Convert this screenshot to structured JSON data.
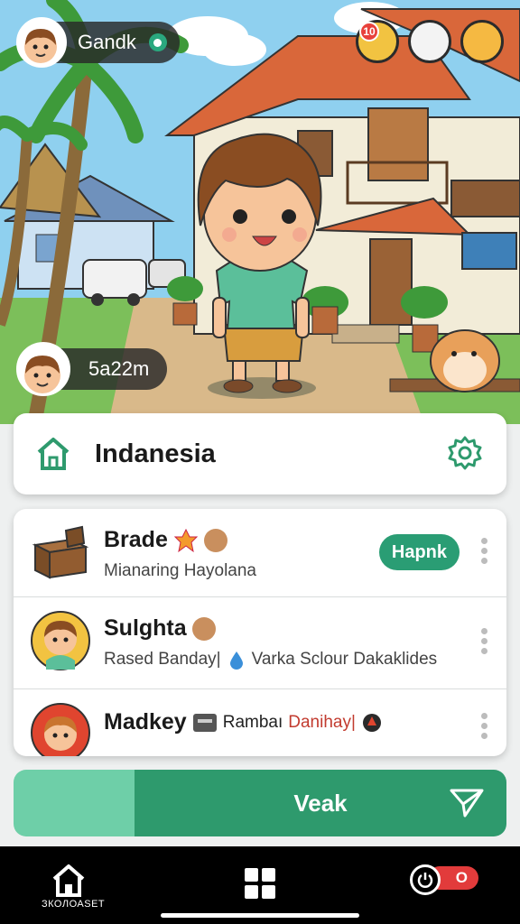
{
  "header": {
    "user_name": "Gandk",
    "score": "5a22m",
    "notification_count": "10"
  },
  "location": {
    "title": "Indanesia",
    "home_icon": "home-icon",
    "settings_icon": "gear-icon"
  },
  "list": [
    {
      "title": "Brade",
      "subtitle": "Mianaring Hayolana",
      "badge": "Hapnk"
    },
    {
      "title": "Sulghta",
      "subtitle_a": "Rased Banday|",
      "subtitle_b": "Varka Sclour Dakaklides"
    },
    {
      "title": "Madkey",
      "subtitle_a": "Rambaı",
      "subtitle_b": "Danihay|"
    }
  ],
  "action": {
    "label": "Veak",
    "icon": "send-icon"
  },
  "nav": {
    "home_label": "ЗКОЛОАSET",
    "toggle_text": "O"
  },
  "colors": {
    "accent": "#2e9a6d",
    "accent_light": "#6ecfa8",
    "danger": "#e23b3b"
  }
}
